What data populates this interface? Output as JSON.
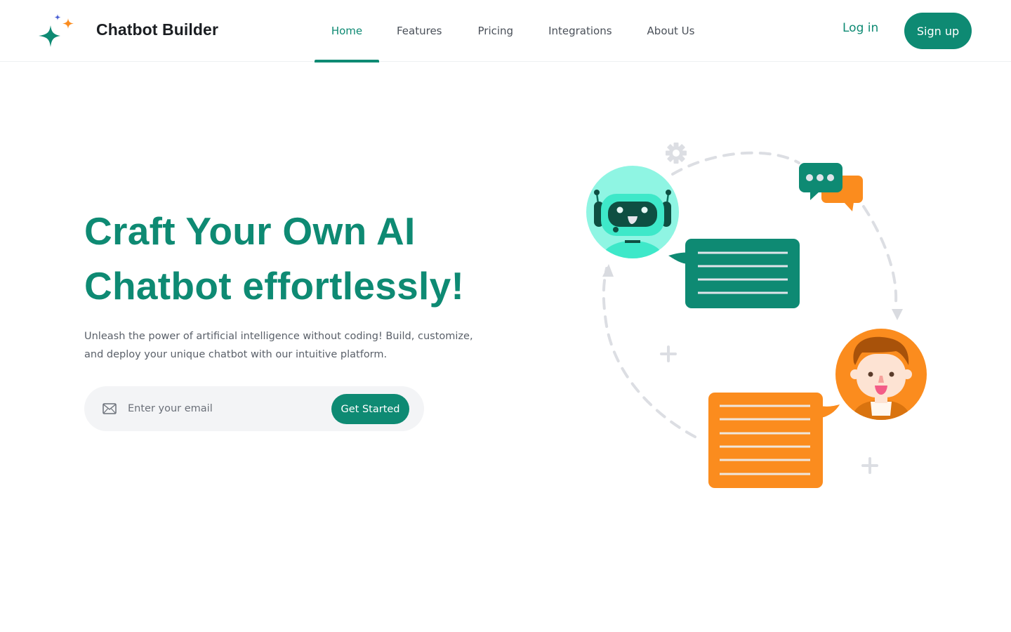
{
  "header": {
    "brand": "Chatbot Builder",
    "logo_icon": "sparkles-icon",
    "nav": [
      {
        "label": "Home",
        "active": true
      },
      {
        "label": "Features",
        "active": false
      },
      {
        "label": "Pricing",
        "active": false
      },
      {
        "label": "Integrations",
        "active": false
      },
      {
        "label": "About Us",
        "active": false
      }
    ],
    "login_label": "Log in",
    "signup_label": "Sign up"
  },
  "hero": {
    "title_line1": "Craft Your Own AI",
    "title_line2": "Chatbot effortlessly!",
    "subtitle": "Unleash the power of artificial intelligence without coding! Build, customize, and deploy your unique chatbot with our intuitive platform.",
    "email_placeholder": "Enter your email",
    "email_value": "",
    "email_icon": "mail-icon",
    "cta_label": "Get Started"
  },
  "illustration": {
    "robot_avatar": "robot-avatar",
    "user_avatar": "user-avatar",
    "bot_message_lines": 4,
    "user_message_lines": 6,
    "typing_dots": 3
  },
  "colors": {
    "primary": "#0e8a73",
    "accent_orange": "#fb8c1e",
    "robot_bg": "#8ff5e3",
    "muted_text": "#5a6069",
    "input_bg": "#f3f4f6",
    "decor_gray": "#d9dbe0"
  }
}
